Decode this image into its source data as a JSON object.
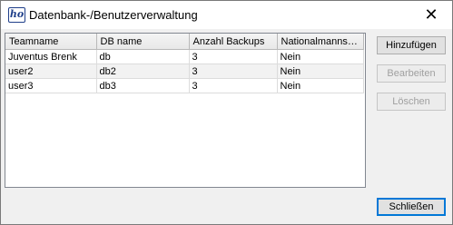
{
  "window": {
    "title": "Datenbank-/Benutzerverwaltung",
    "icon_text": "ho",
    "close_symbol": "✕"
  },
  "table": {
    "columns": [
      "Teamname",
      "DB name",
      "Anzahl Backups",
      "Nationalmannsc..."
    ],
    "rows": [
      [
        "Juventus Brenk",
        "db",
        "3",
        "Nein"
      ],
      [
        "user2",
        "db2",
        "3",
        "Nein"
      ],
      [
        "user3",
        "db3",
        "3",
        "Nein"
      ]
    ]
  },
  "buttons": {
    "add": "Hinzufügen",
    "edit": "Bearbeiten",
    "delete": "Löschen",
    "close": "Schließen"
  }
}
